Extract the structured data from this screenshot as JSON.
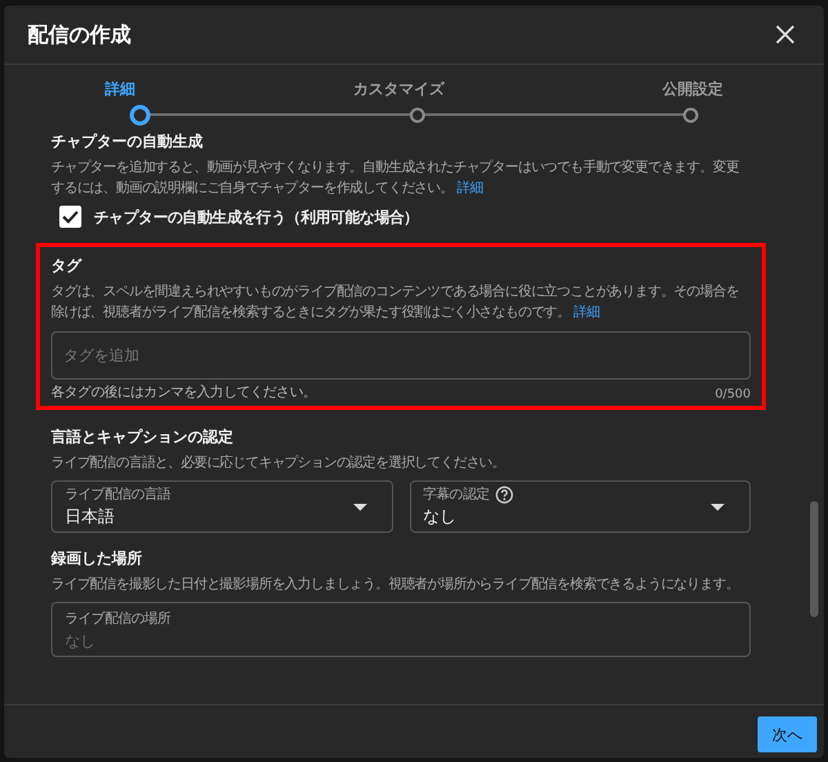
{
  "dialog": {
    "title": "配信の作成"
  },
  "steps": [
    {
      "label": "詳細",
      "selected": true
    },
    {
      "label": "カスタマイズ",
      "selected": false
    },
    {
      "label": "公開設定",
      "selected": false
    }
  ],
  "sections": [
    {
      "kind": "chapters",
      "title": "チャプターの自動生成",
      "description": "チャプターを追加すると、動画が見やすくなります。自動生成されたチャプターはいつでも手動で変更できます。変更するには、動画の説明欄にご自身でチャプターを作成してください。",
      "link": "詳細",
      "checkbox": {
        "label": "チャプターの自動生成を行う（利用可能な場合）",
        "checked": true
      }
    },
    {
      "kind": "tags",
      "highlighted": true,
      "title": "タグ",
      "description": "タグは、スペルを間違えられやすいものがライブ配信のコンテンツである場合に役に立つことがあります。その場合を除けば、視聴者がライブ配信を検索するときにタグが果たす役割はごく小さなものです。",
      "link": "詳細",
      "field": {
        "placeholder": "タグを追加"
      },
      "hint": "各タグの後にはカンマを入力してください。",
      "counter": "0/500"
    },
    {
      "kind": "language",
      "title": "言語とキャプションの認定",
      "description": "ライブ配信の言語と、必要に応じてキャプションの認定を選択してください。",
      "selects": [
        {
          "label": "ライブ配信の言語",
          "value": "日本語"
        },
        {
          "label": "字幕の認定",
          "value": "なし",
          "help": true
        }
      ]
    },
    {
      "kind": "location",
      "title": "録画した場所",
      "description": "ライブ配信を撮影した日付と撮影場所を入力しましょう。視聴者が場所からライブ配信を検索できるようになります。",
      "field": {
        "label": "ライブ配信の場所",
        "placeholder": "なし"
      }
    }
  ],
  "next_button": "次へ"
}
